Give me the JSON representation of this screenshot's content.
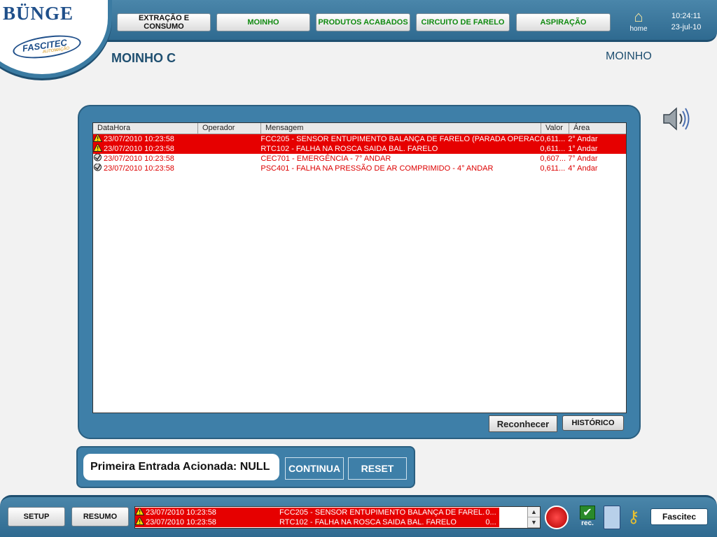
{
  "brand": {
    "logo_text": "BÜNGE",
    "partner_text": "FASCITEC",
    "partner_sub": "AUTOMAÇÃO"
  },
  "nav": {
    "items": [
      {
        "label": "EXTRAÇÃO E CONSUMO",
        "color": "#111111"
      },
      {
        "label": "MOINHO",
        "color": "#118a11"
      },
      {
        "label": "PRODUTOS ACABADOS",
        "color": "#118a11"
      },
      {
        "label": "CIRCUITO DE FARELO",
        "color": "#118a11"
      },
      {
        "label": "ASPIRAÇÃO",
        "color": "#118a11"
      }
    ],
    "home_label": "home"
  },
  "clock": {
    "time": "10:24:11",
    "date": "23-jul-10"
  },
  "page": {
    "title": "MOINHO C",
    "area": "MOINHO"
  },
  "alarms": {
    "columns": {
      "datetime": "DataHora",
      "operator": "Operador",
      "message": "Mensagem",
      "value": "Valor",
      "area": "Área"
    },
    "rows": [
      {
        "datetime": "23/07/2010 10:23:58",
        "operator": "",
        "message": "FCC205 - SENSOR ENTUPIMENTO BALANÇA DE FARELO (PARADA OPERACI...",
        "value": "0,611...",
        "area": "2° Andar",
        "highlight": true,
        "icon": "warning-icon"
      },
      {
        "datetime": "23/07/2010 10:23:58",
        "operator": "",
        "message": "RTC102 - FALHA NA ROSCA SAIDA BAL. FARELO",
        "value": "0,611...",
        "area": "1° Andar",
        "highlight": true,
        "icon": "warning-icon"
      },
      {
        "datetime": "23/07/2010 10:23:58",
        "operator": "",
        "message": "CEC701 - EMERGÊNCIA - 7° ANDAR",
        "value": "0,607...",
        "area": "7° Andar",
        "highlight": false,
        "icon": "acknowledged-icon"
      },
      {
        "datetime": "23/07/2010 10:23:58",
        "operator": "",
        "message": "PSC401 - FALHA NA PRESSÃO DE AR COMPRIMIDO - 4° ANDAR",
        "value": "0,611...",
        "area": "4° Andar",
        "highlight": false,
        "icon": "acknowledged-icon"
      }
    ],
    "acknowledge_label": "Reconhecer",
    "history_label": "HISTÓRICO"
  },
  "first_input": {
    "label": "Primeira Entrada Acionada:  NULL",
    "continue_label": "CONTINUA",
    "reset_label": "RESET"
  },
  "bottom": {
    "setup_label": "SETUP",
    "summary_label": "RESUMO",
    "mini_alarms": [
      {
        "datetime": "23/07/2010 10:23:58",
        "message": "FCC205 - SENSOR ENTUPIMENTO BALANÇA DE FAREL...",
        "value": "0..."
      },
      {
        "datetime": "23/07/2010 10:23:58",
        "message": "RTC102 - FALHA NA ROSCA SAIDA BAL. FARELO",
        "value": "0..."
      }
    ],
    "rec_label": "rec.",
    "user_label": "Fascitec"
  }
}
